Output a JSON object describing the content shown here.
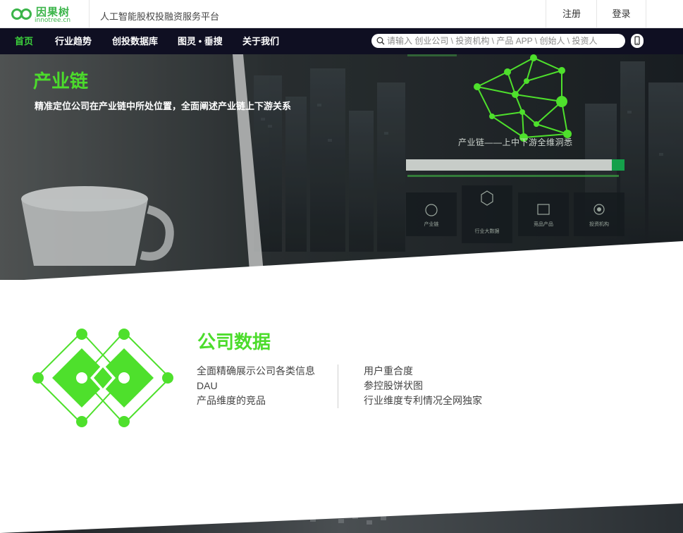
{
  "header": {
    "logo_cn": "因果树",
    "logo_en": "innotree.cn",
    "slogan": "人工智能股权投融资服务平台",
    "register_label": "注册",
    "login_label": "登录"
  },
  "nav": {
    "items": [
      {
        "label": "首页",
        "active": true
      },
      {
        "label": "行业趋势",
        "active": false
      },
      {
        "label": "创投数据库",
        "active": false
      },
      {
        "label": "图灵 • 垂搜",
        "active": false
      },
      {
        "label": "关于我们",
        "active": false
      }
    ],
    "search_placeholder": "请输入 创业公司 \\ 投资机构 \\ 产品 APP \\ 创始人 \\ 投资人"
  },
  "hero": {
    "title": "产业链",
    "subtitle": "精准定位公司在产业链中所处位置，全面阐述产业链上下游关系",
    "caption": "产业链——上中下游全维洞悉",
    "cards": [
      "产业链",
      "行业大数据",
      "竞品产品",
      "投资机构"
    ]
  },
  "company_data": {
    "title": "公司数据",
    "features_left": [
      "全面精确展示公司各类信息",
      "DAU",
      "产品维度的竞品"
    ],
    "features_right": [
      "用户重合度",
      "参控股饼状图",
      "行业维度专利情况全网独家"
    ]
  },
  "colors": {
    "brand_green": "#4cdc2c",
    "logo_green": "#3bb54a",
    "nav_bg": "#0f0f22"
  }
}
